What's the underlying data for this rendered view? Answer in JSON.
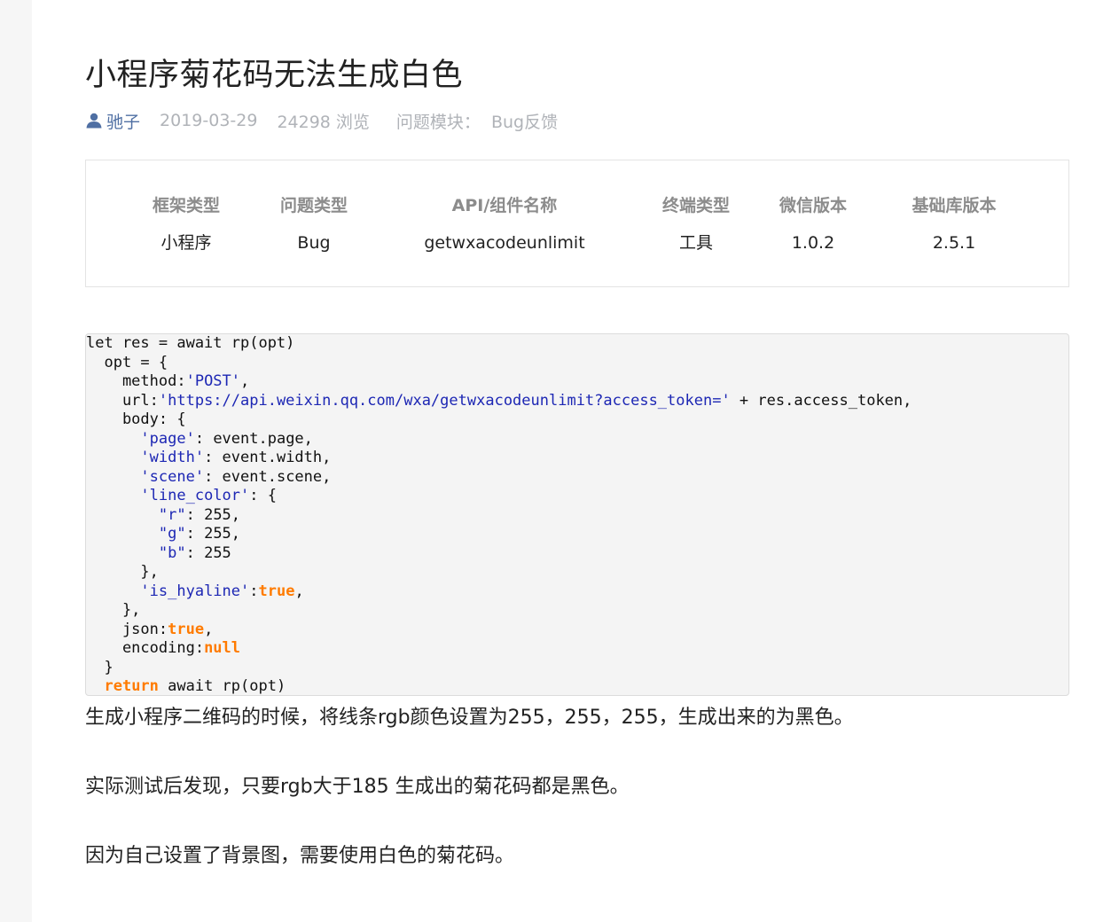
{
  "article": {
    "title": "小程序菊花码无法生成白色",
    "author": "驰子",
    "date": "2019-03-29",
    "views": "24298 浏览",
    "module_label": "问题模块：",
    "module_value": "Bug反馈"
  },
  "info_table": {
    "headers": [
      "框架类型",
      "问题类型",
      "API/组件名称",
      "终端类型",
      "微信版本",
      "基础库版本"
    ],
    "values": [
      "小程序",
      "Bug",
      "getwxacodeunlimit",
      "工具",
      "1.0.2",
      "2.5.1"
    ]
  },
  "code": {
    "lines": [
      [
        {
          "t": "let res = await rp(opt)"
        }
      ],
      [
        {
          "t": "  opt = {"
        }
      ],
      [
        {
          "t": "    method:"
        },
        {
          "t": "'POST'",
          "c": "str"
        },
        {
          "t": ","
        }
      ],
      [
        {
          "t": "    url:"
        },
        {
          "t": "'https://api.weixin.qq.com/wxa/getwxacodeunlimit?access_token='",
          "c": "str"
        },
        {
          "t": " + res.access_token,"
        }
      ],
      [
        {
          "t": "    body: {"
        }
      ],
      [
        {
          "t": "      "
        },
        {
          "t": "'page'",
          "c": "str"
        },
        {
          "t": ": event.page,"
        }
      ],
      [
        {
          "t": "      "
        },
        {
          "t": "'width'",
          "c": "str"
        },
        {
          "t": ": event.width,"
        }
      ],
      [
        {
          "t": "      "
        },
        {
          "t": "'scene'",
          "c": "str"
        },
        {
          "t": ": event.scene,"
        }
      ],
      [
        {
          "t": "      "
        },
        {
          "t": "'line_color'",
          "c": "str"
        },
        {
          "t": ": {"
        }
      ],
      [
        {
          "t": "        "
        },
        {
          "t": "\"r\"",
          "c": "str"
        },
        {
          "t": ": 255,"
        }
      ],
      [
        {
          "t": "        "
        },
        {
          "t": "\"g\"",
          "c": "str"
        },
        {
          "t": ": 255,"
        }
      ],
      [
        {
          "t": "        "
        },
        {
          "t": "\"b\"",
          "c": "str"
        },
        {
          "t": ": 255"
        }
      ],
      [
        {
          "t": "      },"
        }
      ],
      [
        {
          "t": "      "
        },
        {
          "t": "'is_hyaline'",
          "c": "str"
        },
        {
          "t": ":"
        },
        {
          "t": "true",
          "c": "kw"
        },
        {
          "t": ","
        }
      ],
      [
        {
          "t": "    },"
        }
      ],
      [
        {
          "t": "    json:"
        },
        {
          "t": "true",
          "c": "kw"
        },
        {
          "t": ","
        }
      ],
      [
        {
          "t": "    encoding:"
        },
        {
          "t": "null",
          "c": "kw"
        }
      ],
      [
        {
          "t": "  }"
        }
      ],
      [
        {
          "t": "  "
        },
        {
          "t": "return",
          "c": "kw"
        },
        {
          "t": " await rp(opt)"
        }
      ]
    ]
  },
  "paragraphs": [
    "生成小程序二维码的时候，将线条rgb颜色设置为255，255，255，生成出来的为黑色。",
    "实际测试后发现，只要rgb大于185 生成出的菊花码都是黑色。",
    "因为自己设置了背景图，需要使用白色的菊花码。"
  ],
  "colors": {
    "author": "#4f6fa3",
    "meta": "#b0b3b8",
    "code_string": "#1d27b4",
    "code_keyword": "#ff7b00"
  },
  "icons": {
    "author": "user-icon"
  }
}
